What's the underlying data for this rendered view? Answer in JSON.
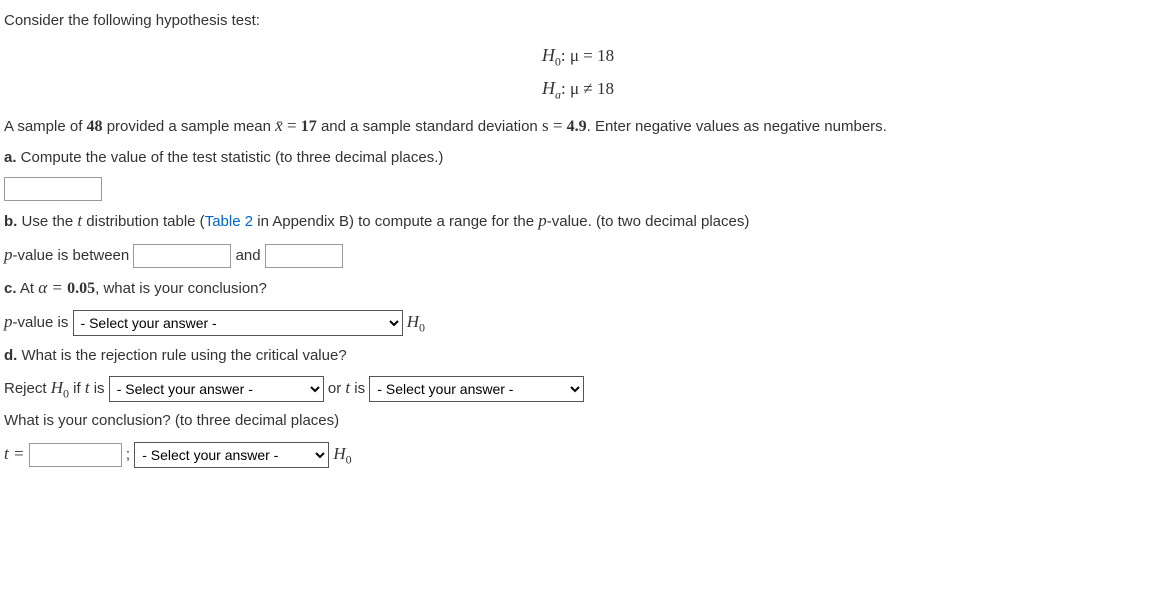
{
  "intro": "Consider the following hypothesis test:",
  "hyp": {
    "h0_label": "H",
    "h0_sub": "0",
    "h0_rhs": ": μ = 18",
    "ha_label": "H",
    "ha_sub": "a",
    "ha_rhs": ": μ ≠ 18"
  },
  "sample_line": {
    "p1": "A sample of ",
    "n": "48",
    "p2": " provided a sample mean ",
    "xbar": "x̄",
    "eq1": " = ",
    "mean": "17",
    "p3": " and a sample standard deviation ",
    "s_eq": "s = ",
    "s": "4.9",
    "p4": ". Enter negative values as negative numbers."
  },
  "a": {
    "label": "a.",
    "text": " Compute the value of the test statistic (to three decimal places.)"
  },
  "b": {
    "label": "b.",
    "text1": " Use the ",
    "t": "t",
    "text2": " distribution table (",
    "link": "Table 2",
    "text3": " in Appendix B) to compute a range for the ",
    "p": "p",
    "text4": "-value. (to two decimal places)",
    "between1": "p",
    "between2": "-value is between ",
    "and": " and "
  },
  "c": {
    "label": "c.",
    "text1": " At ",
    "alpha": "α = ",
    "alpha_val": "0.05",
    "text2": ", what is your conclusion?",
    "pval1": "p",
    "pval2": "-value is ",
    "select_default": "- Select your answer -",
    "h0": "H",
    "h0_sub": "0"
  },
  "d": {
    "label": "d.",
    "text": " What is the rejection rule using the critical value?",
    "reject1": "Reject ",
    "h0": "H",
    "h0_sub": "0",
    "reject2": " if ",
    "t": "t",
    "reject3": " is ",
    "or": " or ",
    "t2": "t",
    "is2": " is ",
    "select_default": "- Select your answer -",
    "concl": "What is your conclusion? (to three decimal places)",
    "teq": "t = ",
    "semi": " ; "
  }
}
